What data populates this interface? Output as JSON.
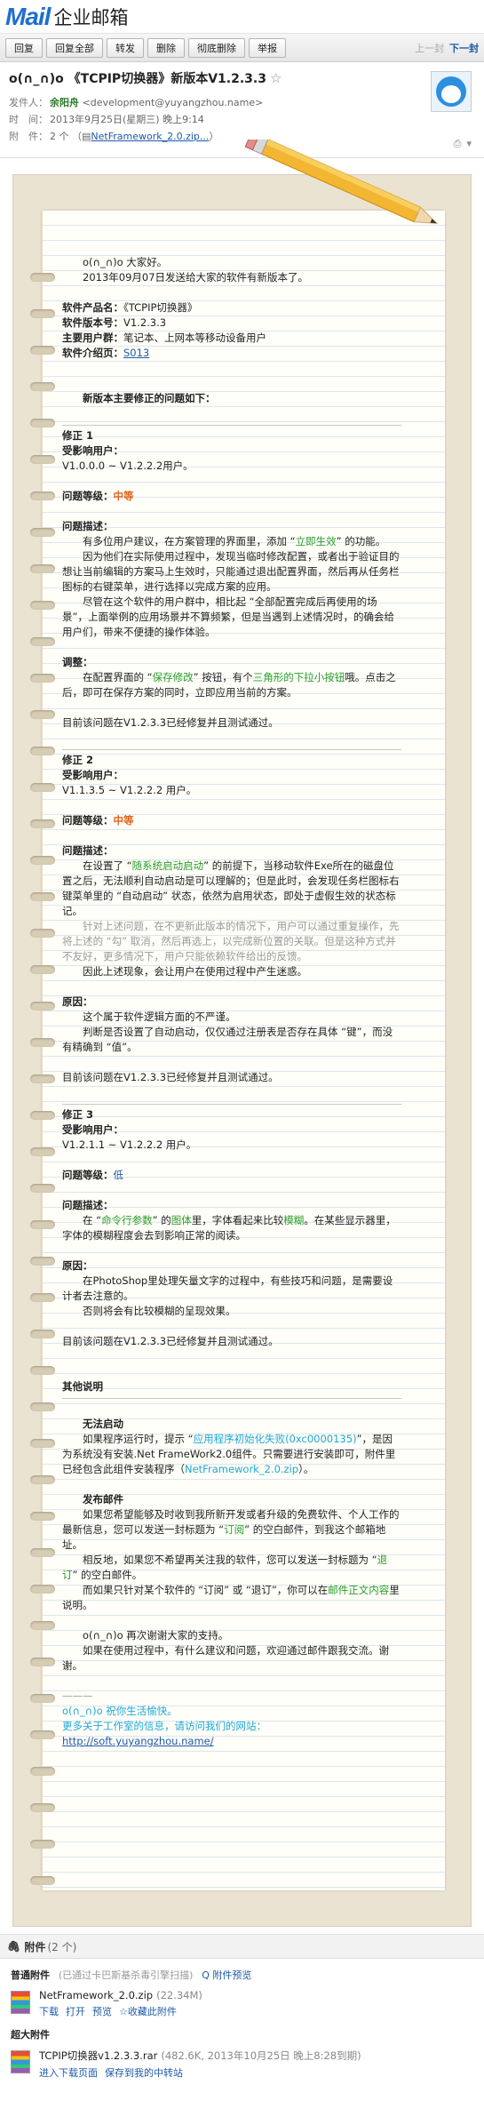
{
  "app": {
    "logo_main": "Mail",
    "logo_sub": "企业邮箱"
  },
  "toolbar": {
    "buttons": [
      "回复",
      "回复全部",
      "转发",
      "删除",
      "彻底删除",
      "举报"
    ],
    "prev": "上一封",
    "next": "下一封"
  },
  "mail": {
    "subject": "o(∩_∩)o 《TCPIP切换器》新版本V1.2.3.3",
    "star": "☆",
    "sender_key": "发件人：",
    "sender_name": "余阳舟",
    "sender_email": "<development@yuyangzhou.name>",
    "time_key": "时　间：",
    "time_value": "2013年9月25日(星期三) 晚上9:14",
    "attach_key": "附　件：",
    "attach_count": "2 个",
    "attach_name": "NetFramework_2.0.zip...",
    "attach_suffix": "）"
  },
  "body": {
    "greeting": "o(∩_∩)o  大家好。",
    "greeting2": "2013年09月07日发送给大家的软件有新版本了。",
    "product_name_k": "软件产品名：",
    "product_name_v": "《TCPIP切换器》",
    "version_k": "软件版本号：",
    "version_v": "V1.2.3.3",
    "users_k": "主要用户群：",
    "users_v": "笔记本、上网本等移动设备用户",
    "intro_k": "软件介绍页：",
    "intro_v": "S013",
    "fix_title": "新版本主要修正的问题如下：",
    "fix1_title": "修正 1",
    "affected_k": "受影响用户：",
    "fix1_affected": "V1.0.0.0 ~ V1.2.2.2用户。",
    "level_k": "问题等级：",
    "fix1_level": "中等",
    "desc_k": "问题描述：",
    "fix1_d1a": "有多位用户建议，在方案管理的界面里，添加 “",
    "fix1_d1b": "立即生效",
    "fix1_d1c": "” 的功能。",
    "fix1_d2": "因为他们在实际使用过程中，发现当临时修改配置，或者出于验证目的想让当前编辑的方案马上生效时，只能通过退出配置界面，然后再从任务栏图标的右键菜单，进行选择以完成方案的应用。",
    "fix1_d3": "尽管在这个软件的用户群中，相比起 “全部配置完成后再使用的场景”，上面举例的应用场景并不算频繁，但是当遇到上述情况时，的确会给用户们，带来不便捷的操作体验。",
    "adjust_k": "调整：",
    "fix1_a1": "在配置界面的 “",
    "fix1_a2": "保存修改",
    "fix1_a3": "” 按钮，有个",
    "fix1_a4": "三角形的下拉小按钮",
    "fix1_a5": "哦。点击之后，即可在保存方案的同时，立即应用当前的方案。",
    "fixed_line": "目前该问题在V1.2.3.3已经修复并且测试通过。",
    "fix2_title": "修正 2",
    "fix2_affected": "V1.1.3.5 ~ V1.2.2.2 用户。",
    "fix2_level": "中等",
    "fix2_d1a": "在设置了 “",
    "fix2_d1b": "随系统启动启动",
    "fix2_d1c": "” 的前提下，当移动软件Exe所在的磁盘位置之后，无法顺利自动启动是可以理解的；但是此时，会发现任务栏图标右键菜单里的 “自动启动” 状态，依然为启用状态，即处于虚假生效的状态标记。",
    "fix2_d2": "针对上述问题，在不更新此版本的情况下，用户可以通过重复操作，先将上述的 “勾” 取消，然后再选上，以完成新位置的关联。但是这种方式并不友好，更多情况下，用户只能依赖软件给出的反馈。",
    "fix2_d3": "因此上述现象，会让用户在使用过程中产生迷惑。",
    "reason_k": "原因：",
    "fix2_r1": "这个属于软件逻辑方面的不严谨。",
    "fix2_r2": "判断是否设置了自动启动，仅仅通过注册表是否存在具体 “键”，而没有精确到 “值”。",
    "fix3_title": "修正 3",
    "fix3_affected": "V1.2.1.1 ~ V1.2.2.2 用户。",
    "fix3_level": "低",
    "fix3_d1a": "在 “",
    "fix3_d1b": "命令行参数",
    "fix3_d1c": "” 的",
    "fix3_d1d": "图体",
    "fix3_d1e": "里，字体看起来比较",
    "fix3_d1f": "模糊",
    "fix3_d1g": "。在某些显示器里，字体的模糊程度会去到影响正常的阅读。",
    "fix3_r1": "在PhotoShop里处理矢量文字的过程中，有些技巧和问题，是需要设计者去注意的。",
    "fix3_r2": "否则将会有比较模糊的呈现效果。",
    "other_title": "其他说明",
    "nostart_title": "无法启动",
    "nostart_a": "如果程序运行时，提示 “",
    "nostart_b": "应用程序初始化失败(0xc0000135)",
    "nostart_c": "”，是因为系统没有安装.Net FrameWork2.0组件。只需要进行安装即可，附件里已经包含此组件安装程序（",
    "nostart_d": "NetFramework_2.0.zip",
    "nostart_e": "）。",
    "mail_title": "发布邮件",
    "mail_1a": "如果您希望能够及时收到我所新开发或者升级的免费软件、个人工作的最新信息，您可以发送一封标题为 “",
    "mail_1b": "订阅",
    "mail_1c": "” 的空白邮件，到我这个邮箱地址。",
    "mail_2a": "相反地，如果您不希望再关注我的软件，您可以发送一封标题为 “",
    "mail_2b": "退订",
    "mail_2c": "” 的空白邮件。",
    "mail_3a": "而如果只针对某个软件的 “订阅” 或 “退订”，你可以在",
    "mail_3b": "邮件正文内容",
    "mail_3c": "里说明。",
    "thanks1": "o(∩_∩)o 再次谢谢大家的支持。",
    "thanks2": "如果在使用过程中，有什么建议和问题，欢迎通过邮件跟我交流。谢谢。",
    "sig_dash": "———",
    "sig1": "o(∩_∩)o  祝你生活愉快。",
    "sig2": "更多关于工作室的信息，请访问我们的网站：",
    "sig_link": "http://soft.yuyangzhou.name/"
  },
  "attachments": {
    "title": "附件",
    "count": "(2 个)",
    "normal_title": "普通附件",
    "normal_note": "(已通过卡巴斯基杀毒引擎扫描)",
    "normal_preview": "Q 附件预览",
    "file1_name": "NetFramework_2.0.zip",
    "file1_size": "(22.34M)",
    "file1_actions": [
      "下载",
      "打开",
      "预览",
      "☆收藏此附件"
    ],
    "big_title": "超大附件",
    "file2_name": "TCPIP切换器v1.2.3.3.rar",
    "file2_size": "(482.6K, 2013年10月25日 晚上8:28到期)",
    "file2_actions": [
      "进入下载页面",
      "保存到我的中转站"
    ]
  },
  "colors": {
    "link": "#1e5aa8",
    "green": "#2a9d2a",
    "orange": "#e0641b",
    "logo": "#1e6fd0"
  }
}
